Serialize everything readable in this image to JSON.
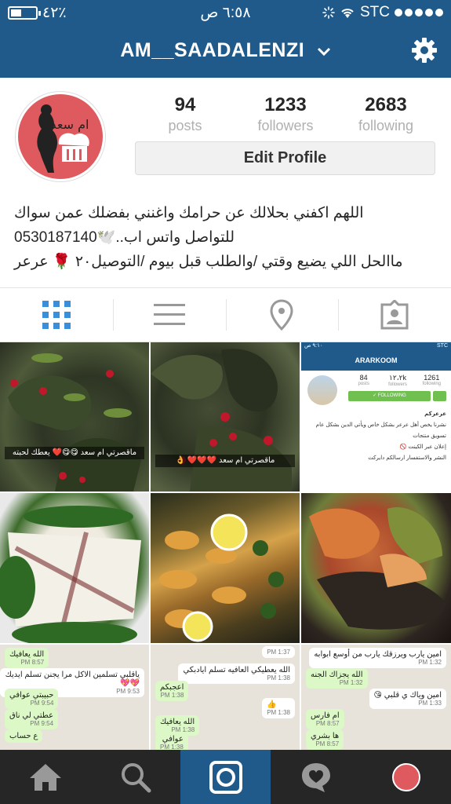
{
  "status": {
    "battery": "٤٢٪",
    "battery_level": 0.42,
    "time": "٦:٥٨ ص",
    "carrier": "STC"
  },
  "header": {
    "username": "AM__SAADALENZI"
  },
  "profile": {
    "avatar_text": "ام سعد",
    "posts": "94",
    "posts_label": "posts",
    "followers": "1233",
    "followers_label": "followers",
    "following": "2683",
    "following_label": "following",
    "edit_label": "Edit Profile",
    "bio": [
      "اللهم اكفني بحلالك عن حرامك واغنني بفضلك عمن سواك",
      "للتواصل واتس اب..🕊️0530187140",
      "ماالحل اللي يضيع وقتي /والطلب قبل بيوم /التوصيل٢٠ 🌹 عرعر"
    ]
  },
  "tabs": [
    {
      "name": "tab-grid",
      "icon": "grid-icon",
      "active": true
    },
    {
      "name": "tab-list",
      "icon": "list-icon",
      "active": false
    },
    {
      "name": "tab-places",
      "icon": "location-pin-icon",
      "active": false
    },
    {
      "name": "tab-tagged",
      "icon": "tagged-person-icon",
      "active": false
    }
  ],
  "grid": {
    "c1_caption": "ماقصرتي ام سعد 😋😋❤️ يعطك لحبته",
    "c2_caption": "ماقصرتي ام سعد ❤️❤️❤️ 👌",
    "c3": {
      "status_left": "٩:١٠ ص",
      "status_right": "STC",
      "title": "ARARKOOM",
      "posts": "84",
      "posts_label": "posts",
      "followers": "١٢،٢k",
      "followers_label": "followers",
      "following": "1261",
      "following_label": "following",
      "follow_label": "✓ FOLLOWING",
      "bio": [
        "عرعركم",
        "نشرنا يخص أهل عرعر بشكل خاص ويأتي الدين بشكل عام",
        "تسويق منتجات",
        "إعلان عبر الكينت 🚫",
        "النشر والاستفسار ارسالكم دايركت"
      ]
    },
    "chat1": [
      {
        "text": "الله يعافيك",
        "time": "8:57 PM",
        "dir": "out"
      },
      {
        "text": "ياقلبي تسلمين الاكل مرا يجنن تسلم ايديك 💖💖",
        "time": "9:53 PM",
        "dir": "in"
      },
      {
        "text": "حبيبتي عوافي",
        "time": "9:54 PM",
        "dir": "out"
      },
      {
        "text": "عطتي لي ناق",
        "time": "9:54 PM",
        "dir": "out"
      },
      {
        "text": "ع حساب",
        "time": "",
        "dir": "out"
      }
    ],
    "chat2": [
      {
        "text": "",
        "time": "1:37 PM",
        "dir": "in"
      },
      {
        "text": "الله يعطيكي العافيه تسلم ايادبكي",
        "time": "1:38 PM",
        "dir": "in"
      },
      {
        "text": "اعجبكم",
        "time": "1:38 PM",
        "dir": "out"
      },
      {
        "text": "👍",
        "time": "1:38 PM",
        "dir": "in"
      },
      {
        "text": "الله يعافيك",
        "time": "1:38 PM",
        "dir": "out"
      },
      {
        "text": "عوافي",
        "time": "1:38 PM",
        "dir": "out"
      }
    ],
    "chat3": [
      {
        "text": "امين يارب ويرزقك يارب من أوسع ابوابه",
        "time": "1:32 PM",
        "dir": "in"
      },
      {
        "text": "الله يجزاك الجنه",
        "time": "1:32 PM",
        "dir": "out"
      },
      {
        "text": "امين وياك ي قلبي 😘",
        "time": "1:33 PM",
        "dir": "in"
      },
      {
        "text": "ام فارس",
        "time": "8:57 PM",
        "dir": "out"
      },
      {
        "text": "ها بشري",
        "time": "8:57 PM",
        "dir": "out"
      }
    ]
  },
  "bottom_nav": [
    {
      "name": "nav-home",
      "icon": "home-icon"
    },
    {
      "name": "nav-search",
      "icon": "search-icon"
    },
    {
      "name": "nav-camera",
      "icon": "camera-icon",
      "active": true
    },
    {
      "name": "nav-activity",
      "icon": "heart-bubble-icon"
    },
    {
      "name": "nav-profile",
      "icon": "avatar"
    }
  ],
  "colors": {
    "brand": "#1f5a8a",
    "nav_bg": "#262626",
    "grid_icon_active": "#3b8ed8",
    "avatar_bg": "#de5a5e"
  }
}
